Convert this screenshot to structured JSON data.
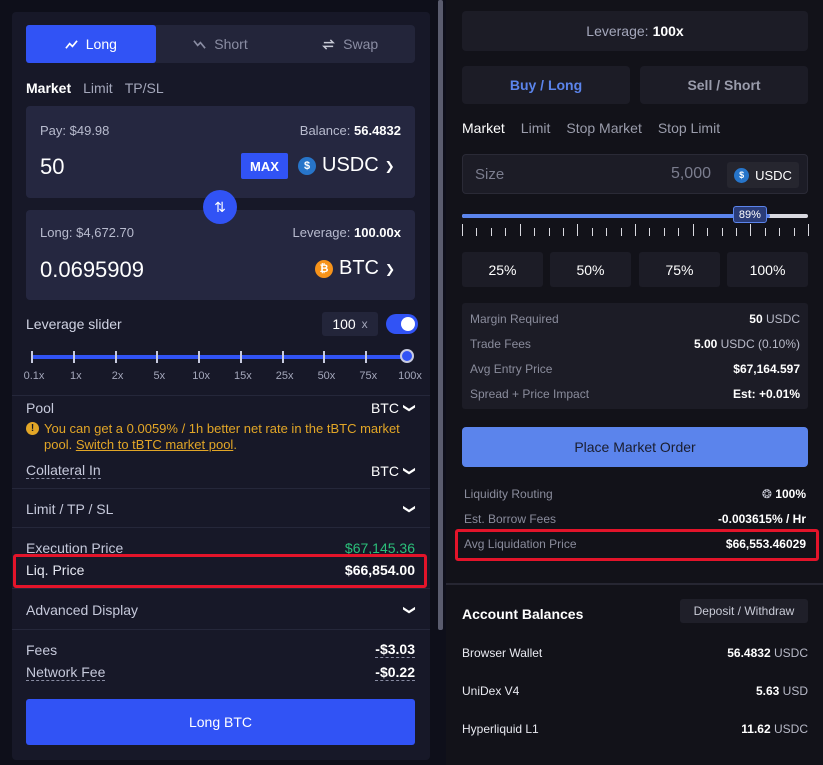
{
  "left": {
    "tabs": [
      {
        "label": "Long"
      },
      {
        "label": "Short"
      },
      {
        "label": "Swap"
      }
    ],
    "order_tabs": [
      "Market",
      "Limit",
      "TP/SL"
    ],
    "pay": {
      "label": "Pay: $49.98",
      "balance_label": "Balance:",
      "balance_value": "56.4832",
      "amount": "50",
      "max": "MAX",
      "token": "USDC"
    },
    "long": {
      "label": "Long: $4,672.70",
      "leverage_label": "Leverage:",
      "leverage_value": "100.00x",
      "amount": "0.0695909",
      "token": "BTC"
    },
    "leverage_slider": {
      "label": "Leverage slider",
      "value": "100",
      "unit": "x",
      "enabled": true,
      "marks": [
        "0.1x",
        "1x",
        "2x",
        "5x",
        "10x",
        "15x",
        "25x",
        "50x",
        "75x",
        "100x"
      ]
    },
    "pool": {
      "label": "Pool",
      "value": "BTC"
    },
    "warning": {
      "text": "You can get a 0.0059% / 1h better net rate in the tBTC market pool. ",
      "link": "Switch to tBTC market pool",
      "suffix": "."
    },
    "collateral": {
      "label": "Collateral In",
      "value": "BTC"
    },
    "limit_section": "Limit / TP / SL",
    "execution_price": {
      "label": "Execution Price",
      "value": "$67,145.36"
    },
    "liq_price": {
      "label": "Liq. Price",
      "value": "$66,854.00"
    },
    "advanced_display": "Advanced Display",
    "fees": {
      "label": "Fees",
      "value": "-$3.03"
    },
    "network_fee": {
      "label": "Network Fee",
      "value": "-$0.22"
    },
    "cta": "Long BTC"
  },
  "right": {
    "leverage": {
      "label": "Leverage:",
      "value": "100x"
    },
    "buy": "Buy / Long",
    "sell": "Sell / Short",
    "order_tabs": [
      "Market",
      "Limit",
      "Stop Market",
      "Stop Limit"
    ],
    "size": {
      "placeholder": "Size",
      "value": "5,000",
      "unit": "USDC"
    },
    "slider": {
      "percent_label": "89%",
      "fraction": 0.89
    },
    "presets": [
      "25%",
      "50%",
      "75%",
      "100%"
    ],
    "info": [
      {
        "label": "Margin Required",
        "value": "50",
        "unit": "USDC"
      },
      {
        "label": "Trade Fees",
        "value": "5.00",
        "unit": "USDC (0.10%)"
      },
      {
        "label": "Avg Entry Price",
        "value": "$67,164.597",
        "unit": ""
      },
      {
        "label": "Spread + Price Impact",
        "value": "Est: +0.01%",
        "unit": ""
      }
    ],
    "place_order": "Place Market Order",
    "liquidity_routing": {
      "label": "Liquidity Routing",
      "value": "100%"
    },
    "borrow_fees": {
      "label": "Est. Borrow Fees",
      "value": "-0.003615% / Hr"
    },
    "avg_liq": {
      "label": "Avg Liquidation Price",
      "value": "$66,553.46029"
    },
    "account_balances": "Account Balances",
    "deposit_withdraw": "Deposit / Withdraw",
    "balances": [
      {
        "label": "Browser Wallet",
        "value": "56.4832",
        "unit": "USDC"
      },
      {
        "label": "UniDex V4",
        "value": "5.63",
        "unit": "USD"
      },
      {
        "label": "Hyperliquid L1",
        "value": "11.62",
        "unit": "USDC"
      }
    ]
  },
  "colors": {
    "accent": "#3153f5",
    "accent_right": "#5b84ec",
    "warning": "#e2a627",
    "positive": "#2bbf7a",
    "highlight": "#e3142a"
  }
}
